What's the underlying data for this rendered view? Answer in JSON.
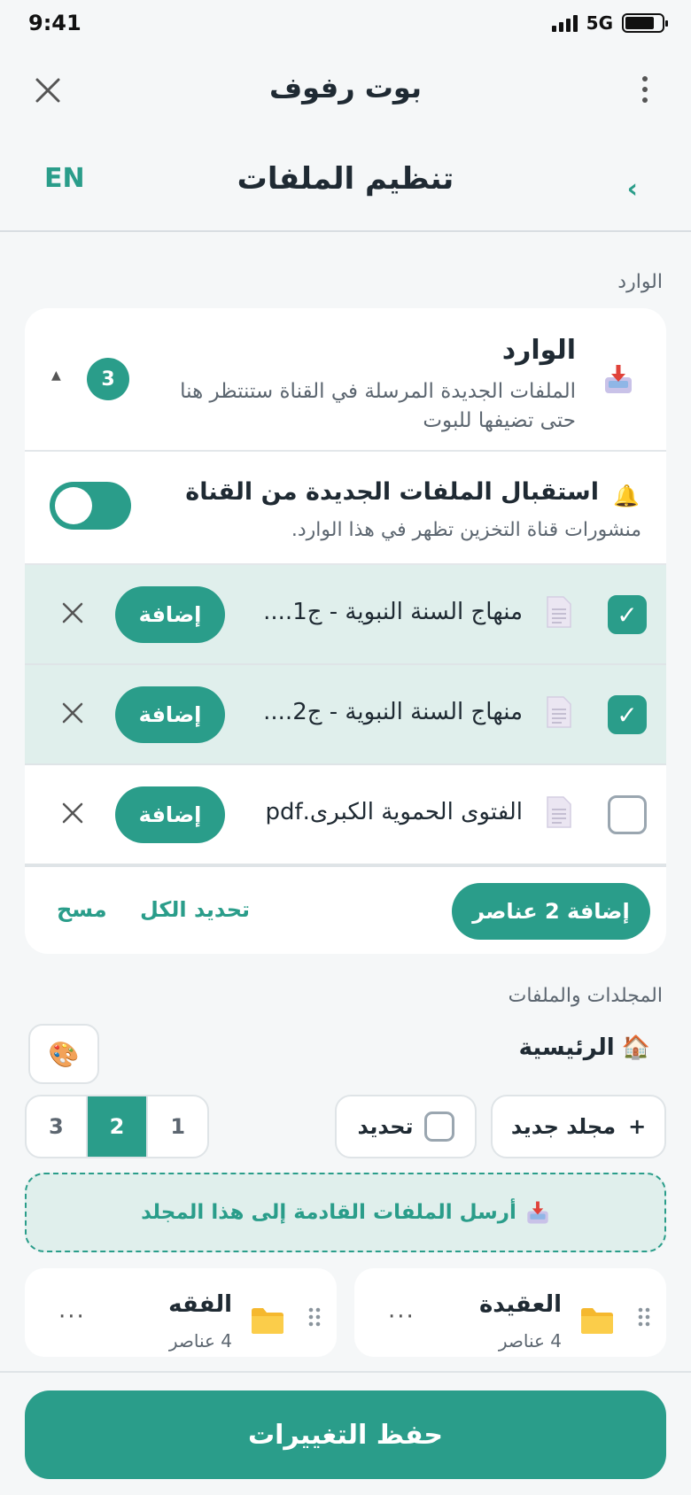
{
  "status": {
    "time": "9:41",
    "network": "5G"
  },
  "header": {
    "app_title": "بوت رفوف",
    "page_title": "تنظيم الملفات",
    "lang_toggle": "EN",
    "back_glyph": "›"
  },
  "inbox_section_label": "الوارد",
  "inbox": {
    "title": "الوارد",
    "description": "الملفات الجديدة المرسلة في القناة ستنتظر هنا حتى تضيفها للبوت",
    "count": "3",
    "receive": {
      "title": "استقبال الملفات الجديدة من القناة",
      "description": "منشورات قناة التخزين تظهر في هذا الوارد.",
      "enabled": true
    },
    "files": [
      {
        "name": "منهاج السنة النبوية - ج1....",
        "selected": true,
        "add_label": "إضافة"
      },
      {
        "name": "منهاج السنة النبوية - ج2....",
        "selected": true,
        "add_label": "إضافة"
      },
      {
        "name": "الفتوى الحموية الكبرى.pdf",
        "selected": false,
        "add_label": "إضافة"
      }
    ],
    "add_selected_label": "إضافة 2 عناصر",
    "select_all_label": "تحديد الكل",
    "clear_label": "مسح"
  },
  "folders_section_label": "المجلدات والملفات",
  "breadcrumb": {
    "home_label": "الرئيسية",
    "home_icon": "🏠",
    "palette_icon": "🎨"
  },
  "toolbar": {
    "new_folder_label": "مجلد جديد",
    "new_folder_glyph": "+",
    "select_label": "تحديد",
    "columns": [
      "1",
      "2",
      "3"
    ],
    "active_column": "2"
  },
  "dropzone_label": "أرسل الملفات القادمة إلى هذا المجلد",
  "folders": [
    {
      "name": "العقيدة",
      "count": "4 عناصر"
    },
    {
      "name": "الفقه",
      "count": "4 عناصر"
    }
  ],
  "save_label": "حفظ التغييرات",
  "colors": {
    "accent": "#2a9d8a",
    "selected_row": "#e0efec"
  }
}
